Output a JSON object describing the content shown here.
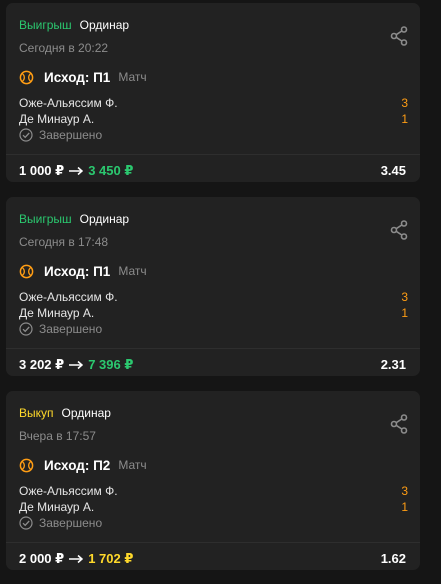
{
  "colors": {
    "background": "#151515",
    "card": "#222222",
    "win": "#2bc86f",
    "buyout": "#ffd92b",
    "score": "#ff9d14",
    "muted": "#8c8c8c"
  },
  "icons": {
    "share": "share-icon",
    "sport": "tennis-ball-icon",
    "check": "check-circle-icon",
    "arrow": "arrow-right-icon"
  },
  "bets": [
    {
      "status": "Выигрыш",
      "type": "Ординар",
      "datetime": "Сегодня в 20:22",
      "outcome": "Исход: П1",
      "market": "Матч",
      "team1": "Оже-Альяссим Ф.",
      "team2": "Де Минаур А.",
      "score1": "3",
      "score2": "1",
      "result": "Завершено",
      "stake": "1 000 ₽",
      "payout": "3 450 ₽",
      "coefficient": "3.45"
    },
    {
      "status": "Выигрыш",
      "type": "Ординар",
      "datetime": "Сегодня в 17:48",
      "outcome": "Исход: П1",
      "market": "Матч",
      "team1": "Оже-Альяссим Ф.",
      "team2": "Де Минаур А.",
      "score1": "3",
      "score2": "1",
      "result": "Завершено",
      "stake": "3 202 ₽",
      "payout": "7 396 ₽",
      "coefficient": "2.31"
    },
    {
      "status": "Выкуп",
      "type": "Ординар",
      "datetime": "Вчера в 17:57",
      "outcome": "Исход: П2",
      "market": "Матч",
      "team1": "Оже-Альяссим Ф.",
      "team2": "Де Минаур А.",
      "score1": "3",
      "score2": "1",
      "result": "Завершено",
      "stake": "2 000 ₽",
      "payout": "1 702 ₽",
      "coefficient": "1.62"
    }
  ]
}
